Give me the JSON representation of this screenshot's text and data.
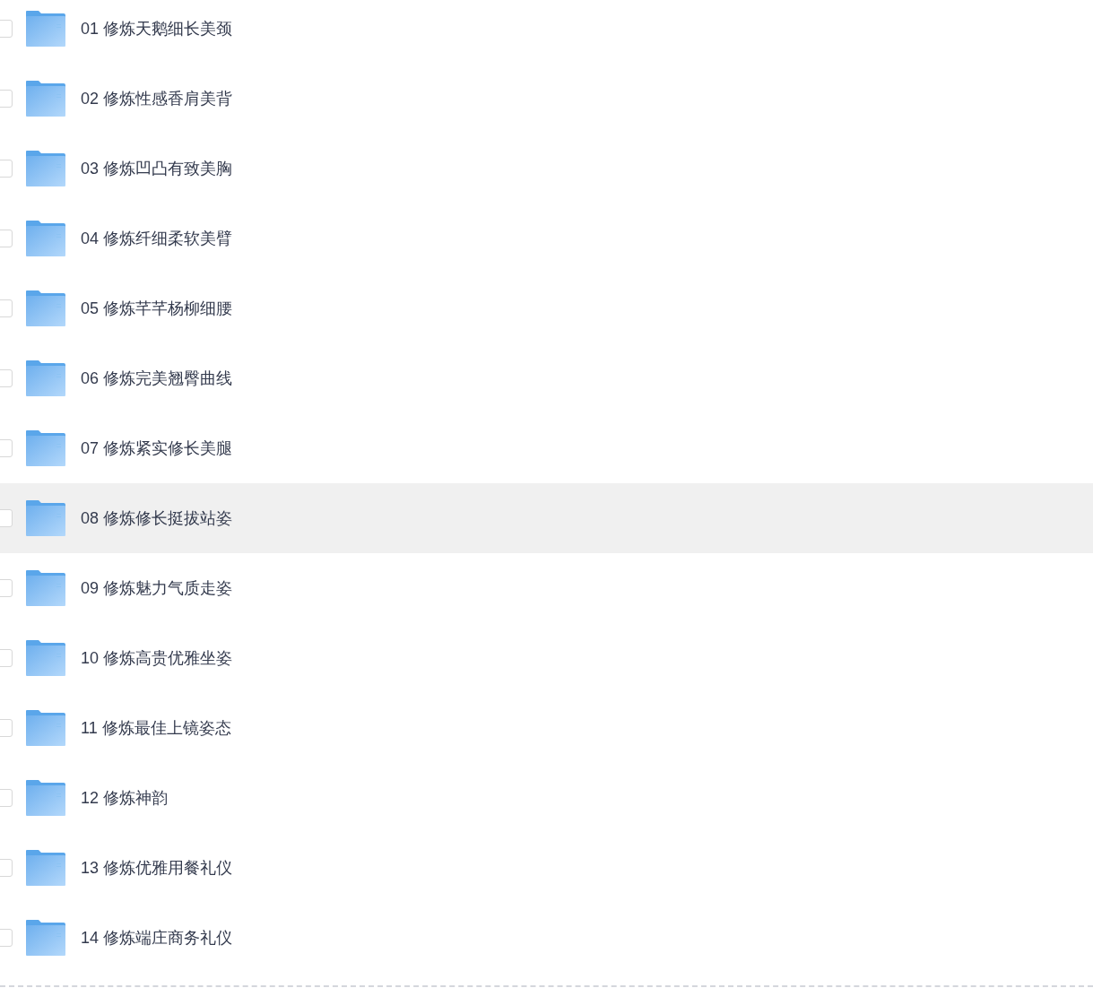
{
  "folders": [
    {
      "name": "01 修炼天鹅细长美颈",
      "checked": false,
      "highlighted": false
    },
    {
      "name": "02 修炼性感香肩美背",
      "checked": false,
      "highlighted": false
    },
    {
      "name": "03 修炼凹凸有致美胸",
      "checked": false,
      "highlighted": false
    },
    {
      "name": "04 修炼纤细柔软美臂",
      "checked": false,
      "highlighted": false
    },
    {
      "name": "05 修炼芊芊杨柳细腰",
      "checked": false,
      "highlighted": false
    },
    {
      "name": "06 修炼完美翘臀曲线",
      "checked": false,
      "highlighted": false
    },
    {
      "name": "07 修炼紧实修长美腿",
      "checked": false,
      "highlighted": false
    },
    {
      "name": "08 修炼修长挺拔站姿",
      "checked": false,
      "highlighted": true
    },
    {
      "name": "09 修炼魅力气质走姿",
      "checked": false,
      "highlighted": false
    },
    {
      "name": "10 修炼高贵优雅坐姿",
      "checked": false,
      "highlighted": false
    },
    {
      "name": "11 修炼最佳上镜姿态",
      "checked": false,
      "highlighted": false
    },
    {
      "name": "12 修炼神韵",
      "checked": false,
      "highlighted": false
    },
    {
      "name": "13 修炼优雅用餐礼仪",
      "checked": false,
      "highlighted": false
    },
    {
      "name": "14 修炼端庄商务礼仪",
      "checked": false,
      "highlighted": false
    }
  ]
}
